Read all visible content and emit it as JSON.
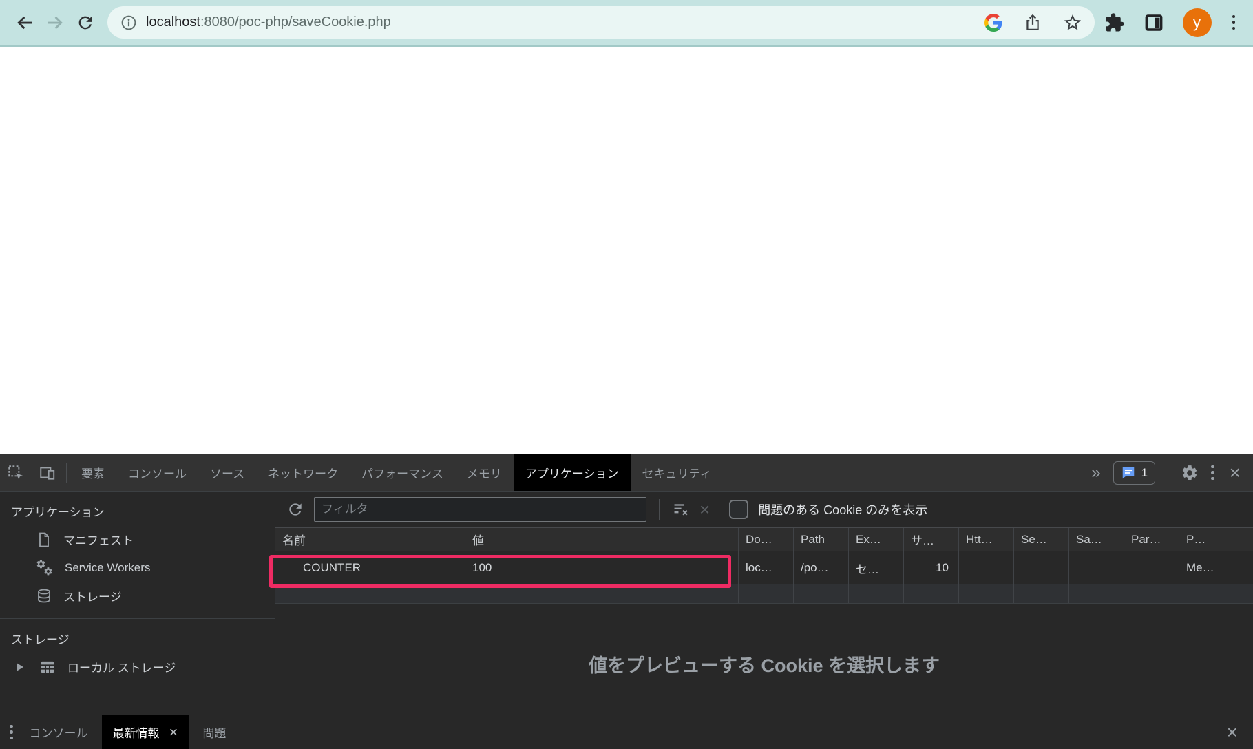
{
  "browser": {
    "url": {
      "host": "localhost",
      "rest": ":8080/poc-php/saveCookie.php"
    },
    "avatar_label": "y"
  },
  "devtools": {
    "tabs": [
      "要素",
      "コンソール",
      "ソース",
      "ネットワーク",
      "パフォーマンス",
      "メモリ",
      "アプリケーション",
      "セキュリティ"
    ],
    "selected_tab": "アプリケーション",
    "more_symbol": "»",
    "messages_count": "1",
    "close_symbol": "×",
    "sidebar": {
      "app_section_title": "アプリケーション",
      "app_items": [
        "マニフェスト",
        "Service Workers",
        "ストレージ"
      ],
      "storage_section_title": "ストレージ",
      "storage_items": [
        "ローカル ストレージ"
      ]
    },
    "cookie_toolbar": {
      "filter_placeholder": "フィルタ",
      "clear_symbol": "×",
      "only_issues_label": "問題のある Cookie のみを表示"
    },
    "table": {
      "columns": [
        "名前",
        "値",
        "Do…",
        "Path",
        "Ex…",
        "サ…",
        "Htt…",
        "Se…",
        "Sa…",
        "Par…",
        "P…"
      ],
      "row": [
        "COUNTER",
        "100",
        "loc…",
        "/po…",
        "セ…",
        "10",
        "",
        "",
        "",
        "",
        "Me…"
      ]
    },
    "preview_message": "値をプレビューする Cookie を選択します",
    "drawer": {
      "tabs": [
        "コンソール",
        "最新情報",
        "問題"
      ],
      "selected_tab": "最新情報",
      "close_symbol": "×"
    }
  },
  "colors": {
    "highlight_pink": "#ee2b63",
    "chrome_teal": "#c4e3e1",
    "avatar_orange": "#e8710a",
    "badge_blue": "#669df6"
  }
}
